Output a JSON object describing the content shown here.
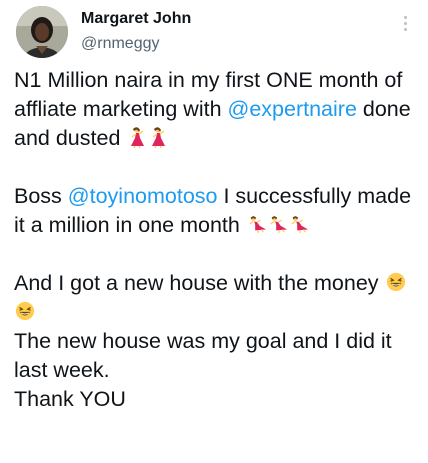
{
  "user": {
    "display_name": "Margaret John",
    "handle": "@rnmeggy"
  },
  "menu": {
    "more_icon": "more-vertical-icon"
  },
  "tweet": {
    "p1_a": "N1 Million naira in my first ONE month of affliate marketing with ",
    "p1_mention": "@expertnaire",
    "p1_b": "  done and dusted ",
    "p2_a": "Boss ",
    "p2_mention": "@toyinomotoso",
    "p2_b": "  I successfully made it a million in one month ",
    "p3": "And I got a new house with the money ",
    "p4": "The new house was my goal and I did it last week.",
    "p5": "Thank YOU"
  },
  "emojis": {
    "p1": [
      "woman-dancing-emoji",
      "woman-dancing-emoji"
    ],
    "p2": [
      "woman-dancing-emoji",
      "woman-dancing-emoji",
      "woman-dancing-emoji"
    ],
    "p3": [
      "grinning-squinting-face-emoji",
      "grinning-squinting-face-emoji"
    ]
  },
  "colors": {
    "text": "#0f1419",
    "secondary": "#536471",
    "link": "#1d9bf0",
    "dress": "#e0245e",
    "face": "#ffcc4d"
  }
}
